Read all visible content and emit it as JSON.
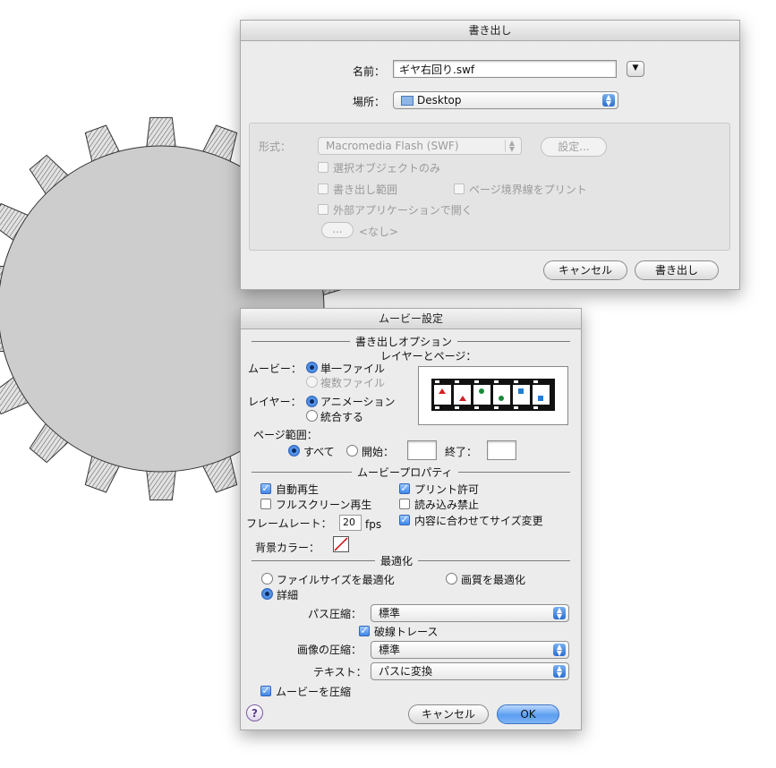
{
  "export_dialog": {
    "title": "書き出し",
    "name_label": "名前：",
    "name_value": "ギヤ右回り.swf",
    "location_label": "場所：",
    "location_value": "Desktop",
    "format_label": "形式：",
    "format_value": "Macromedia Flash (SWF)",
    "settings_button": "設定...",
    "option_selected_only": "選択オブジェクトのみ",
    "option_export_range": "書き出し範囲",
    "option_print_page_border": "ページ境界線をプリント",
    "option_open_external": "外部アプリケーションで開く",
    "browse_button": "...",
    "app_none": "<なし>",
    "cancel_button": "キャンセル",
    "export_button": "書き出し"
  },
  "movie_dialog": {
    "title": "ムービー設定",
    "section_export_options": "書き出しオプション",
    "layers_pages_label": "レイヤーとページ：",
    "movie_label": "ムービー：",
    "movie_single_file": "単一ファイル",
    "movie_multiple_files": "複数ファイル",
    "layer_label": "レイヤー：",
    "layer_animation": "アニメーション",
    "layer_merge": "統合する",
    "page_range_label": "ページ範囲：",
    "page_all": "すべて",
    "page_start": "開始：",
    "page_end": "終了：",
    "page_start_value": "",
    "page_end_value": "",
    "section_movie_properties": "ムービープロパティ",
    "autoplay": "自動再生",
    "fullscreen": "フルスクリーン再生",
    "allow_print": "プリント許可",
    "protect_import": "読み込み禁止",
    "frame_rate_label": "フレームレート：",
    "frame_rate_value": "20",
    "frame_rate_unit": "fps",
    "resize_to_content": "内容に合わせてサイズ変更",
    "bg_color_label": "背景カラー：",
    "section_optimize": "最適化",
    "optimize_file_size": "ファイルサイズを最適化",
    "optimize_quality": "画質を最適化",
    "detailed": "詳細",
    "path_compression_label": "パス圧縮：",
    "path_compression_value": "標準",
    "trace_dotted": "破線トレース",
    "image_compression_label": "画像の圧縮：",
    "image_compression_value": "標準",
    "text_label": "テキスト：",
    "text_value": "パスに変換",
    "compress_movie": "ムービーを圧縮",
    "help_button": "?",
    "cancel_button": "キャンセル",
    "ok_button": "OK"
  },
  "checkbox_states": {
    "selected_only": false,
    "export_range": false,
    "print_page_border": false,
    "open_external": false,
    "autoplay": true,
    "fullscreen": false,
    "allow_print": true,
    "protect_import": false,
    "resize_to_content": true,
    "trace_dotted": true,
    "compress_movie": true
  },
  "radio_states": {
    "movie": "single_file",
    "layer": "animation",
    "page_range": "all",
    "optimize": "detailed"
  },
  "colors": {
    "accent_blue": "#3f86e8",
    "gear_fill": "#cfcfcf",
    "bg_color_swatch_slash": "#cc0000"
  }
}
